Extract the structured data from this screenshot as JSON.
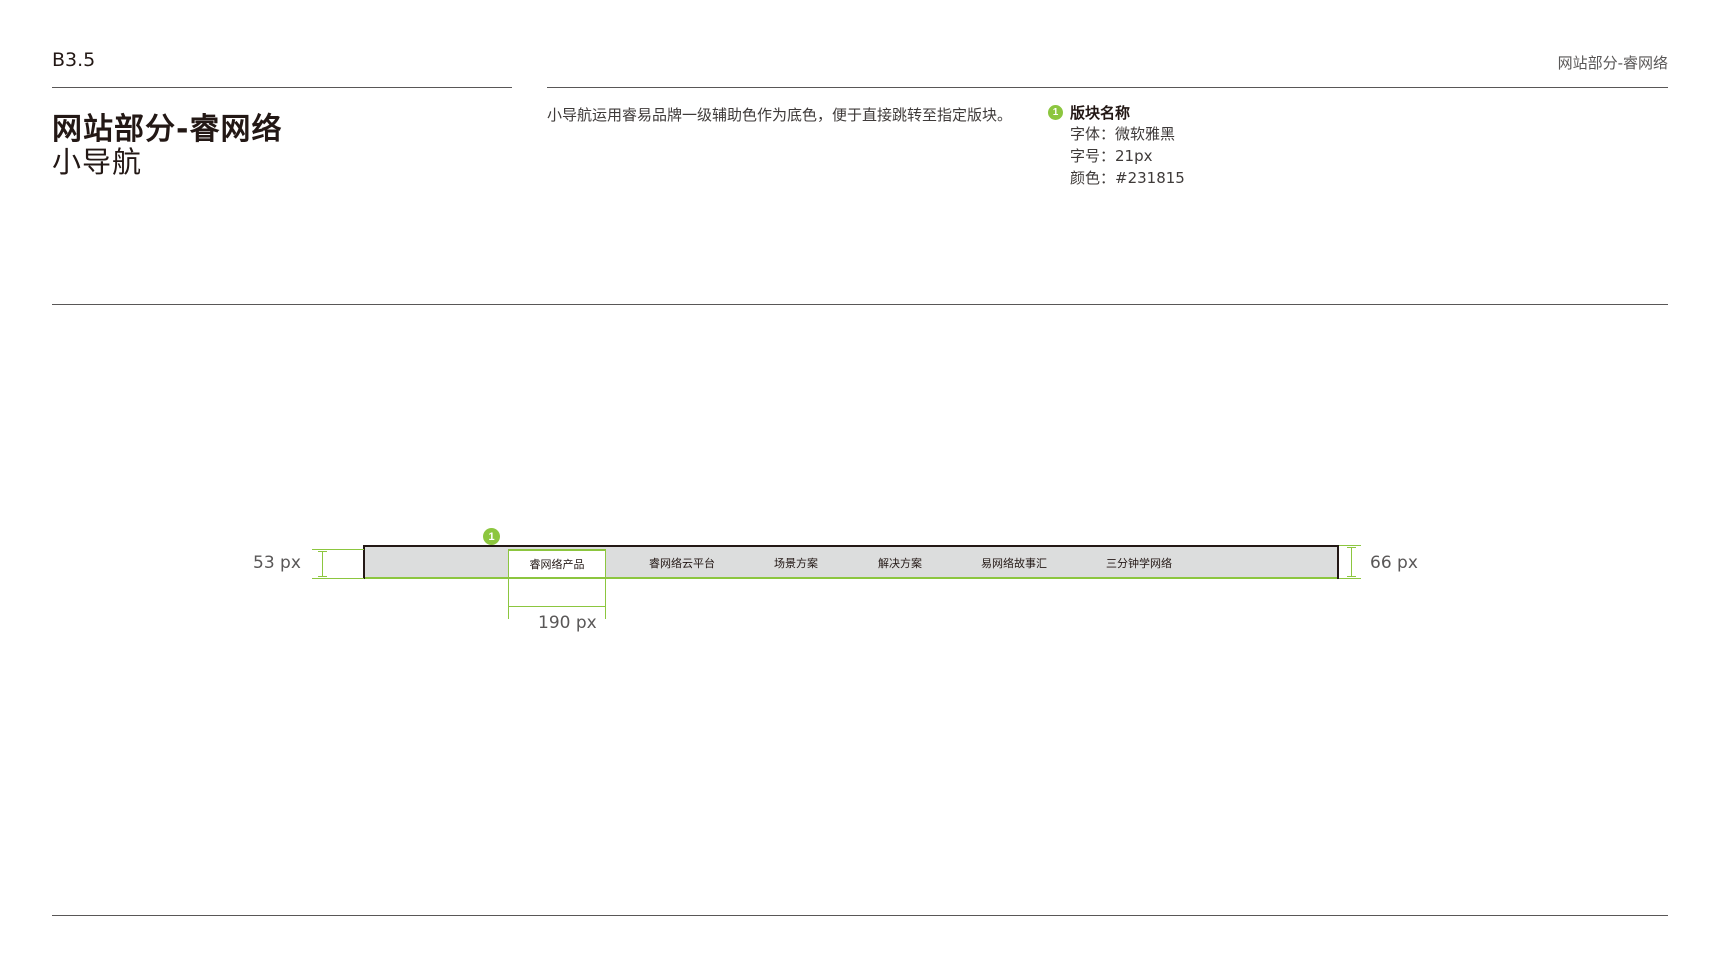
{
  "header": {
    "page_code": "B3.5",
    "section": "网站部分-睿网络"
  },
  "title": {
    "main": "网站部分-睿网络",
    "sub": "小导航"
  },
  "description": "小导航运用睿易品牌一级辅助色作为底色，便于直接跳转至指定版块。",
  "spec": {
    "badge": "1",
    "name": "版块名称",
    "font_label": "字体：",
    "font_value": "微软雅黑",
    "size_label": "字号：",
    "size_value": "21px",
    "color_label": "颜色：",
    "color_value": "#231815"
  },
  "nav": {
    "items": [
      "睿网络产品",
      "睿网络云平台",
      "场景方案",
      "解决方案",
      "易网络故事汇",
      "三分钟学网络"
    ],
    "active_index": 0,
    "badge": "1"
  },
  "dimensions": {
    "left_height": "53  px",
    "right_height": "66  px",
    "item_width": "190  px"
  },
  "colors": {
    "accent_green": "#8cc63f",
    "text_dark": "#231815",
    "nav_background": "#dcdddd",
    "rule": "#595757"
  }
}
